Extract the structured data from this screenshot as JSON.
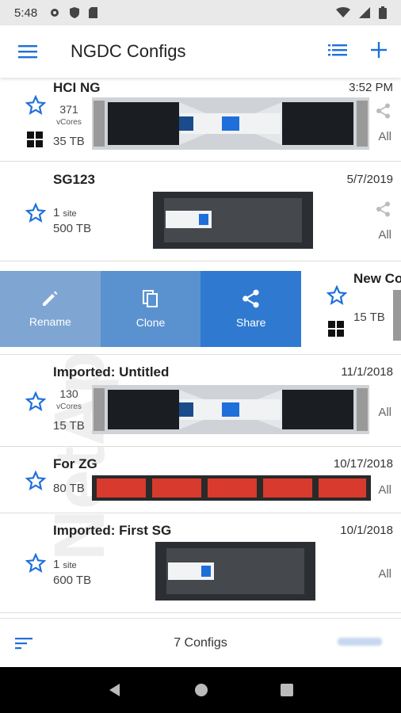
{
  "status_bar": {
    "time": "5:48",
    "icons": [
      "settings-icon",
      "shield-icon",
      "sd-card-icon",
      "wifi-icon",
      "signal-icon",
      "battery-icon"
    ]
  },
  "app_bar": {
    "title": "NGDC Configs",
    "icons": [
      "menu-icon",
      "list-icon",
      "plus-icon"
    ]
  },
  "watermark": {
    "text": "NetApp"
  },
  "configs": [
    {
      "name": "HCI NG",
      "date": "3:52 PM",
      "count": "371",
      "count_unit": "vCores",
      "capacity": "35 TB",
      "scope": "All",
      "device": "hci"
    },
    {
      "name": "SG123",
      "date": "5/7/2019",
      "count": "1",
      "count_unit": "site",
      "capacity": "500 TB",
      "scope": "All",
      "device": "sg"
    },
    {
      "name": "New Co",
      "count": "15 TB",
      "device": "hci"
    },
    {
      "name": "Imported: Untitled",
      "date": "11/1/2018",
      "count": "130",
      "count_unit": "vCores",
      "capacity": "15 TB",
      "scope": "All",
      "device": "hci"
    },
    {
      "name": "For ZG",
      "date": "10/17/2018",
      "capacity": "80 TB",
      "scope": "All",
      "device": "red"
    },
    {
      "name": "Imported: First SG",
      "date": "10/1/2018",
      "count": "1",
      "count_unit": "site",
      "capacity": "600 TB",
      "scope": "All",
      "device": "sg"
    }
  ],
  "swipe_actions": [
    {
      "label": "Rename",
      "icon": "pencil-icon"
    },
    {
      "label": "Clone",
      "icon": "copy-icon"
    },
    {
      "label": "Share",
      "icon": "share-icon"
    }
  ],
  "bottom_bar": {
    "count_text": "7 Configs"
  },
  "colors": {
    "accent": "#1e6fd9",
    "swipe_rename": "#7fa6d2",
    "swipe_clone": "#5a92d0",
    "swipe_share": "#2f7ad0",
    "device_red": "#d83a2e"
  }
}
